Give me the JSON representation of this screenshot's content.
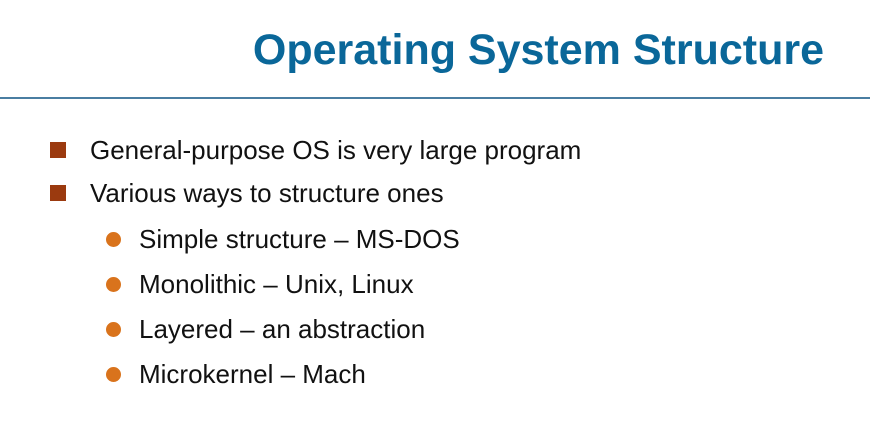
{
  "slide": {
    "title": "Operating System Structure",
    "bullets": [
      {
        "text": "General-purpose OS is very large program"
      },
      {
        "text": "Various ways to structure ones"
      }
    ],
    "sub_bullets": [
      {
        "text": "Simple structure – MS-DOS"
      },
      {
        "text": "Monolithic – Unix, Linux"
      },
      {
        "text": "Layered – an abstraction"
      },
      {
        "text": "Microkernel – Mach"
      }
    ]
  },
  "colors": {
    "title": "#0a6799",
    "rule": "#4a7ea2",
    "square_bullet": "#9b3a0f",
    "circle_bullet": "#d9731c",
    "text": "#111111"
  }
}
